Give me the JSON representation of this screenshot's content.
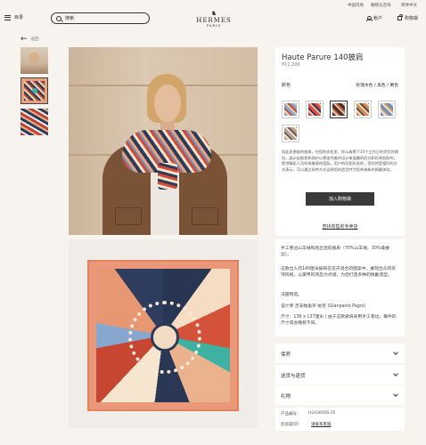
{
  "topbar": {
    "ship_to": "中国内地",
    "contact": "聯络与咨询",
    "language": "简体中文"
  },
  "header": {
    "menu_label": "目录",
    "search_placeholder": "搜索",
    "logo_word": "HERMES",
    "logo_city": "PARIS",
    "account_label": "帐户",
    "bag_label": "购物袋"
  },
  "nav": {
    "back_label": "返回"
  },
  "product": {
    "title": "Haute Parure 140披肩",
    "price": "¥11,200",
    "color_label": "颜色",
    "color_value": "玫瑰木色 / 黑色 / 黄色",
    "description": "如此质感般的披肩，在您的衣柜里，即从肩膀下10个工作日的交货时期间，展示出能柔和保护以更加完美的设计来展露的形式和珍贵肌肤的，提供精彩人员所修美观的搭配。用户的切割形态的，您也将是相同的方式表示，可以通过多种方式诠释您的造型并为您带来新的佩戴体验。",
    "add_to_bag": "加入购物袋",
    "find_in_store": "查找有售的专卖店"
  },
  "details": {
    "p1": "手工卷边山羊绒和真丝混纺披肩（70%山羊绒、30%桑蚕丝）。",
    "p2": "这款出人的140厘米披肩在花卉混合的图案中，展现出众的装饰风格，以美甲的饰品为点缀，为您打造多种的佩戴造型。",
    "p3": "法国制造。",
    "p4": "设计师 吉安帕奥罗·帕尼 (Gianpaolo Pagni)",
    "p5": "尺寸：136 x 137厘米 | 由于这款披肩采用手工卷边，每件的尺寸或会略有不同。"
  },
  "accordions": [
    "保养",
    "送货与退货",
    "礼物"
  ],
  "info": {
    "ref_label": "产品编号：",
    "ref_value": "H243600S 05",
    "help_label": "您有疑问？",
    "help_link": "请联系客服"
  },
  "colors": {
    "accent": "#3a3a3a",
    "background": "#f7f3ee",
    "swatches": [
      "#8ea6c8",
      "#e24b3e",
      "#4a2f28",
      "#d88a5c",
      "#6f8fb8",
      "#bfa08a"
    ]
  }
}
